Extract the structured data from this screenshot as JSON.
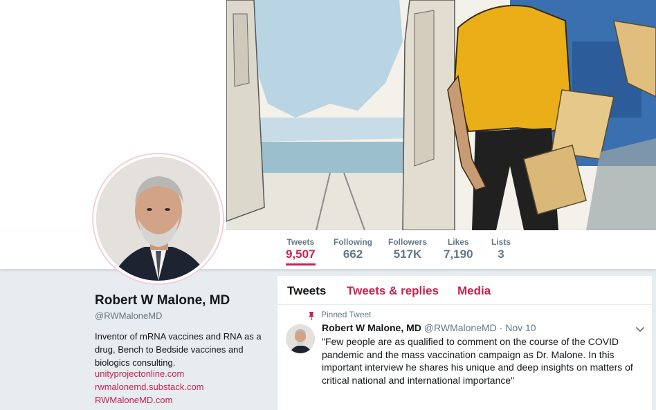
{
  "profile": {
    "name": "Robert W Malone, MD",
    "handle": "@RWMaloneMD",
    "bio": "Inventor of mRNA vaccines and RNA as a drug, Bench to Bedside vaccines and biologics consulting.",
    "links": [
      "unityprojectonline.com",
      "rwmalonemd.substack.com",
      "RWMaloneMD.com"
    ]
  },
  "nav": {
    "stats": [
      {
        "label": "Tweets",
        "value": "9,507"
      },
      {
        "label": "Following",
        "value": "662"
      },
      {
        "label": "Followers",
        "value": "517K"
      },
      {
        "label": "Likes",
        "value": "7,190"
      },
      {
        "label": "Lists",
        "value": "3"
      }
    ]
  },
  "timeline": {
    "tabs": [
      "Tweets",
      "Tweets & replies",
      "Media"
    ],
    "pinned_label": "Pinned Tweet",
    "tweet": {
      "name": "Robert W Malone, MD",
      "handle": "@RWMaloneMD",
      "date": "· Nov 10",
      "text": "\"Few people are as qualified to comment on the course of the COVID pandemic and the mass vaccination campaign as Dr. Malone. In this important interview he shares his unique and deep insights on matters of critical national and international importance\""
    }
  },
  "colors": {
    "accent": "#c8234e",
    "muted": "#657786",
    "page_bg": "#e6ecf0"
  },
  "icons": [
    "pin-icon",
    "chevron-down-icon"
  ]
}
